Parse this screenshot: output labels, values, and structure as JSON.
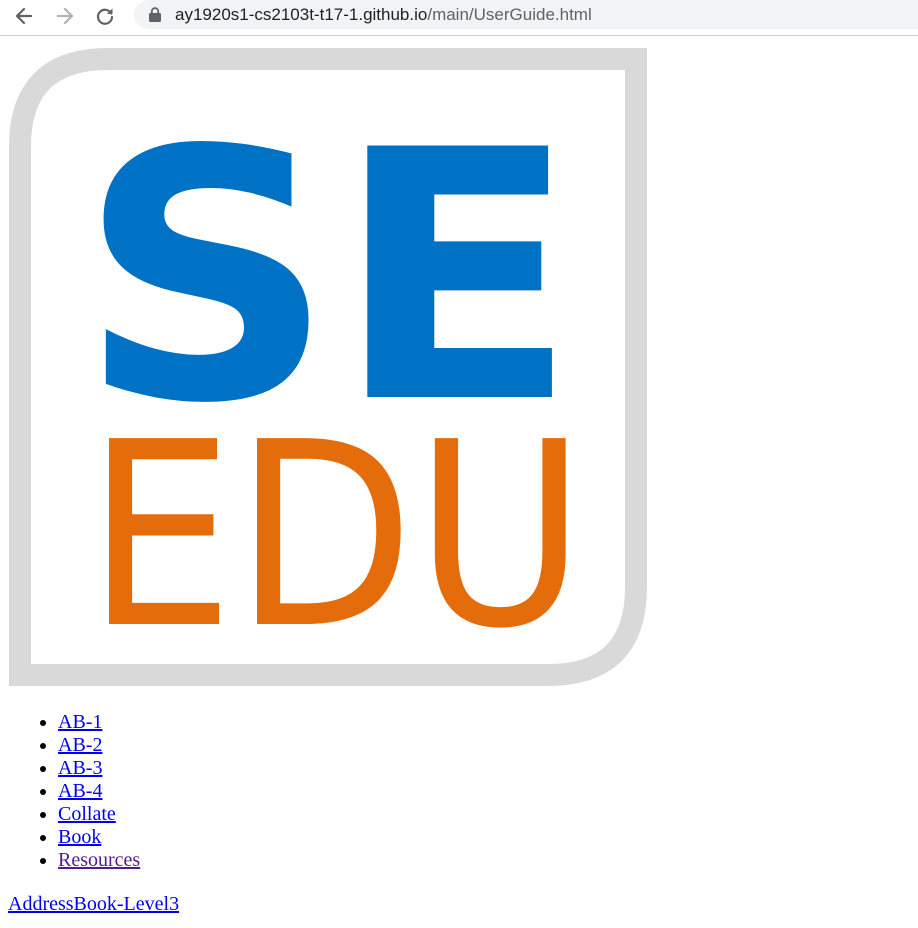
{
  "browser": {
    "url_host": "ay1920s1-cs2103t-t17-1.github.io",
    "url_path": "/main/UserGuide.html",
    "icons": {
      "back": "arrow-left-icon",
      "forward": "arrow-right-icon",
      "reload": "reload-icon",
      "lock": "lock-icon"
    }
  },
  "logo": {
    "line1": "SE",
    "line2": "EDU",
    "colors": {
      "top": "#0072c6",
      "bottom": "#e46c0a",
      "frame": "#d9d9d9"
    }
  },
  "nav": {
    "items": [
      {
        "label": "AB-1"
      },
      {
        "label": "AB-2"
      },
      {
        "label": "AB-3"
      },
      {
        "label": "AB-4"
      },
      {
        "label": "Collate"
      },
      {
        "label": "Book"
      },
      {
        "label": "Resources",
        "visited": true
      }
    ]
  },
  "brand": {
    "label": "AddressBook-Level3"
  },
  "colors": {
    "link": "#0000ee",
    "visited_link": "#551a8b"
  }
}
